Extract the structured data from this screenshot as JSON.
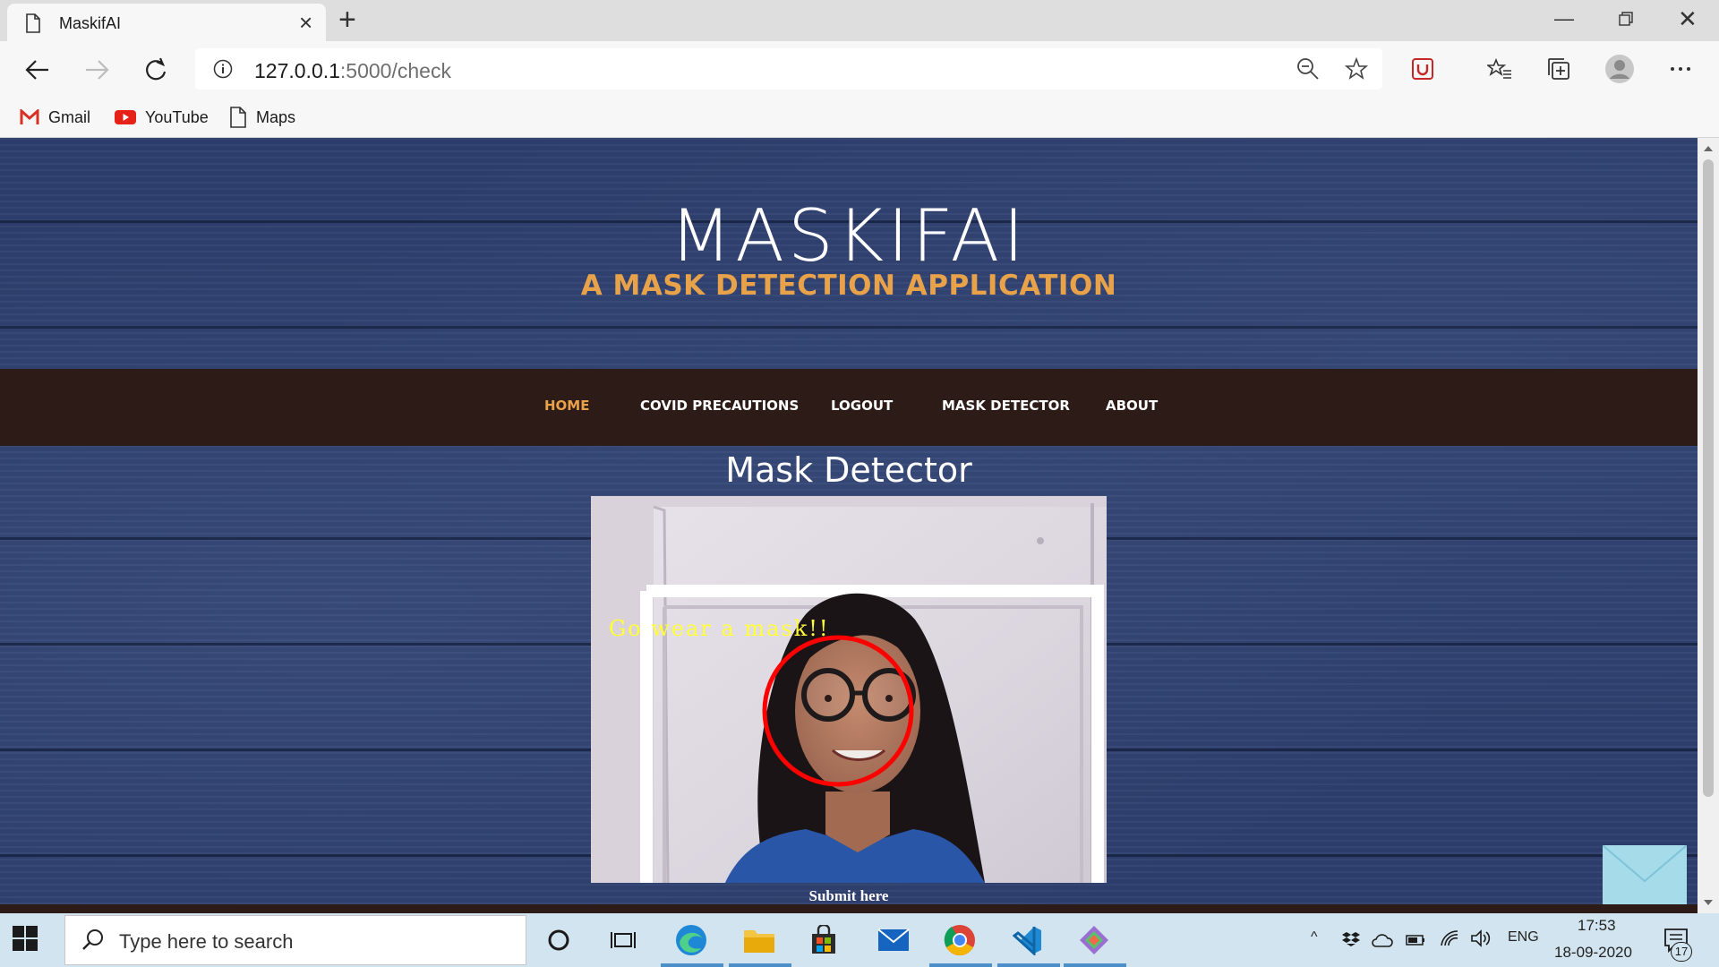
{
  "browser": {
    "tab_title": "MaskifAI",
    "url_host": "127.0.0.1",
    "url_path": ":5000/check",
    "bookmarks": [
      {
        "label": "Gmail",
        "icon": "gmail-icon"
      },
      {
        "label": "YouTube",
        "icon": "youtube-icon"
      },
      {
        "label": "Maps",
        "icon": "page-icon"
      }
    ]
  },
  "site": {
    "title": "MASKIFAI",
    "subtitle": "A MASK DETECTION APPLICATION",
    "nav": [
      {
        "label": "HOME",
        "active": true
      },
      {
        "label": "COVID PRECAUTIONS",
        "active": false
      },
      {
        "label": "LOGOUT",
        "active": false
      },
      {
        "label": "MASK DETECTOR",
        "active": false
      },
      {
        "label": "ABOUT",
        "active": false
      }
    ],
    "section_title": "Mask Detector",
    "detection_label": "Go wear a mask!!",
    "submit_label": "Submit here"
  },
  "colors": {
    "accent": "#e8a24a",
    "nav_bg": "#2c1b17",
    "page_bg": "#2e3f6e",
    "detection_text": "#ffff33",
    "detection_circle": "#ff0000"
  },
  "taskbar": {
    "search_placeholder": "Type here to search",
    "language": "ENG",
    "time": "17:53",
    "date": "18-09-2020",
    "notification_count": "17"
  }
}
